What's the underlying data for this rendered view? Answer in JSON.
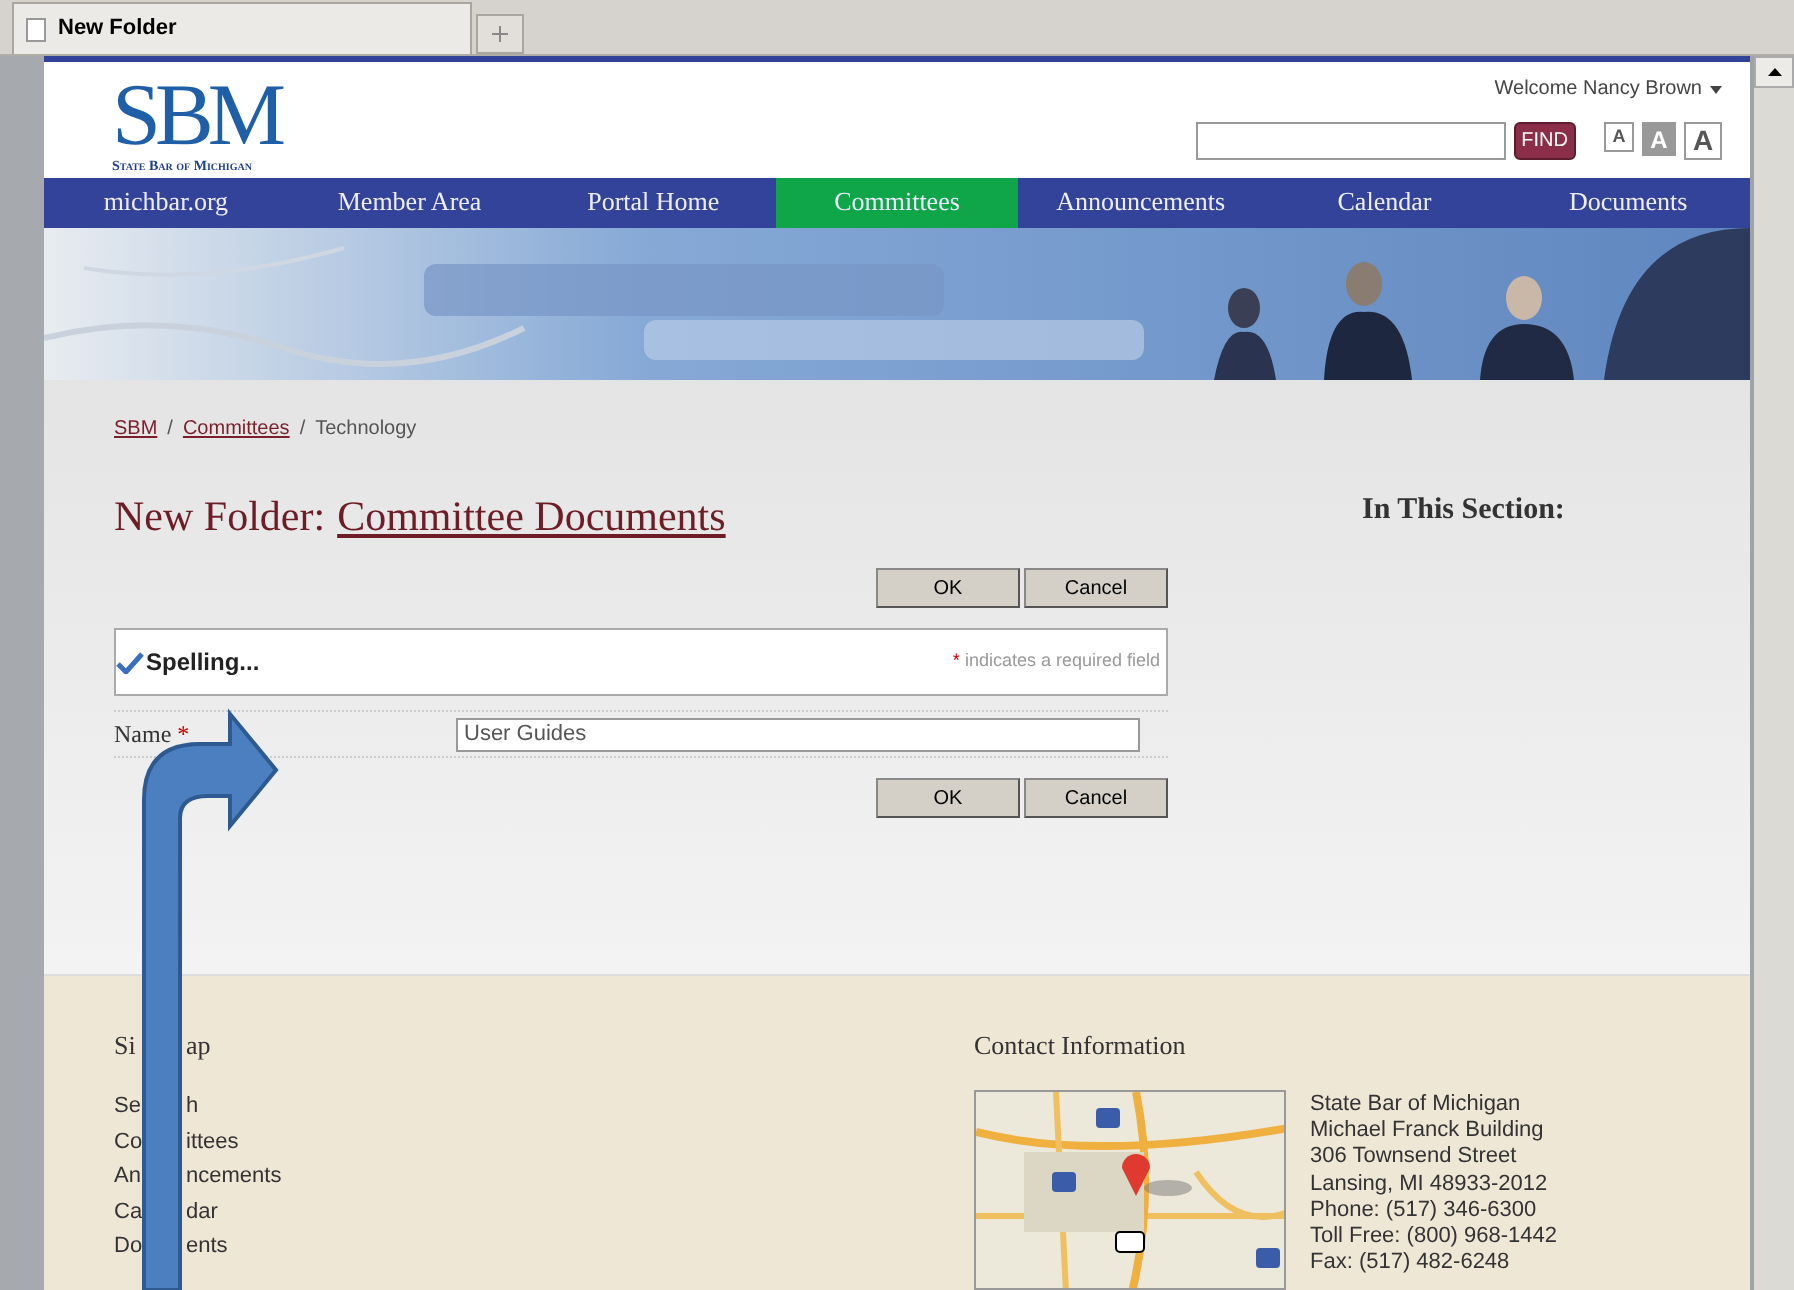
{
  "browser": {
    "tab_title": "New Folder"
  },
  "header": {
    "logo": {
      "mark": "SBM",
      "name": "State Bar of Michigan"
    },
    "welcome": "Welcome Nancy Brown",
    "search": {
      "button": "FIND"
    },
    "text_sizes": [
      {
        "label": "A",
        "kind": "small",
        "selected": false
      },
      {
        "label": "A",
        "kind": "medium",
        "selected": true
      },
      {
        "label": "A",
        "kind": "large",
        "selected": false
      }
    ]
  },
  "nav": [
    {
      "label": "michbar.org",
      "selected": false
    },
    {
      "label": "Member Area",
      "selected": false
    },
    {
      "label": "Portal Home",
      "selected": false
    },
    {
      "label": "Committees",
      "selected": true
    },
    {
      "label": "Announcements",
      "selected": false
    },
    {
      "label": "Calendar",
      "selected": false
    },
    {
      "label": "Documents",
      "selected": false
    }
  ],
  "breadcrumb": {
    "separator": "/",
    "items": [
      {
        "label": "SBM",
        "link": true
      },
      {
        "label": "Committees",
        "link": true
      },
      {
        "label": "Technology",
        "link": false
      }
    ]
  },
  "page_title": {
    "prefix": "New Folder:",
    "link": "Committee Documents"
  },
  "form": {
    "buttons": [
      "OK",
      "Cancel"
    ],
    "spelling": "Spelling...",
    "required_mark": "*",
    "required_note": "indicates a required field",
    "fields": [
      {
        "label": "Name",
        "required": true,
        "value": "User Guides"
      }
    ],
    "bottom_buttons": [
      "OK",
      "Cancel"
    ]
  },
  "side": {
    "title": "In This Section:"
  },
  "footer": {
    "site_map": {
      "title_parts": [
        "Si",
        "ap"
      ],
      "items": [
        {
          "parts": [
            "Se",
            "h"
          ]
        },
        {
          "parts": [
            "Co",
            "ittees"
          ]
        },
        {
          "parts": [
            "An",
            "ncements"
          ]
        },
        {
          "parts": [
            "Ca",
            "dar"
          ]
        },
        {
          "parts": [
            "Do",
            "ents"
          ]
        }
      ]
    },
    "contact": {
      "title": "Contact Information",
      "lines": [
        "State Bar of Michigan",
        "Michael Franck Building",
        "306 Townsend Street",
        "Lansing, MI 48933-2012",
        "Phone: (517) 346-6300",
        "Toll Free: (800) 968-1442",
        "Fax: (517) 482-6248"
      ]
    }
  }
}
